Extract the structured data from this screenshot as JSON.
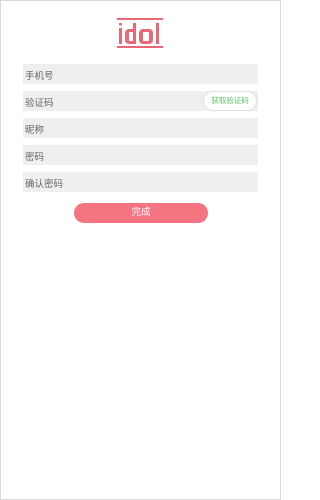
{
  "logo": {
    "brand_color": "#e86a78"
  },
  "form": {
    "phone": {
      "placeholder": "手机号",
      "value": ""
    },
    "code": {
      "placeholder": "验证码",
      "value": ""
    },
    "get_code_label": "获取验证码",
    "nickname": {
      "placeholder": "昵称",
      "value": ""
    },
    "password": {
      "placeholder": "密码",
      "value": ""
    },
    "confirm_password": {
      "placeholder": "确认密码",
      "value": ""
    }
  },
  "submit_label": "完成",
  "colors": {
    "accent": "#f47482",
    "field_bg": "#efefef",
    "code_button_text": "#5fc36a"
  }
}
